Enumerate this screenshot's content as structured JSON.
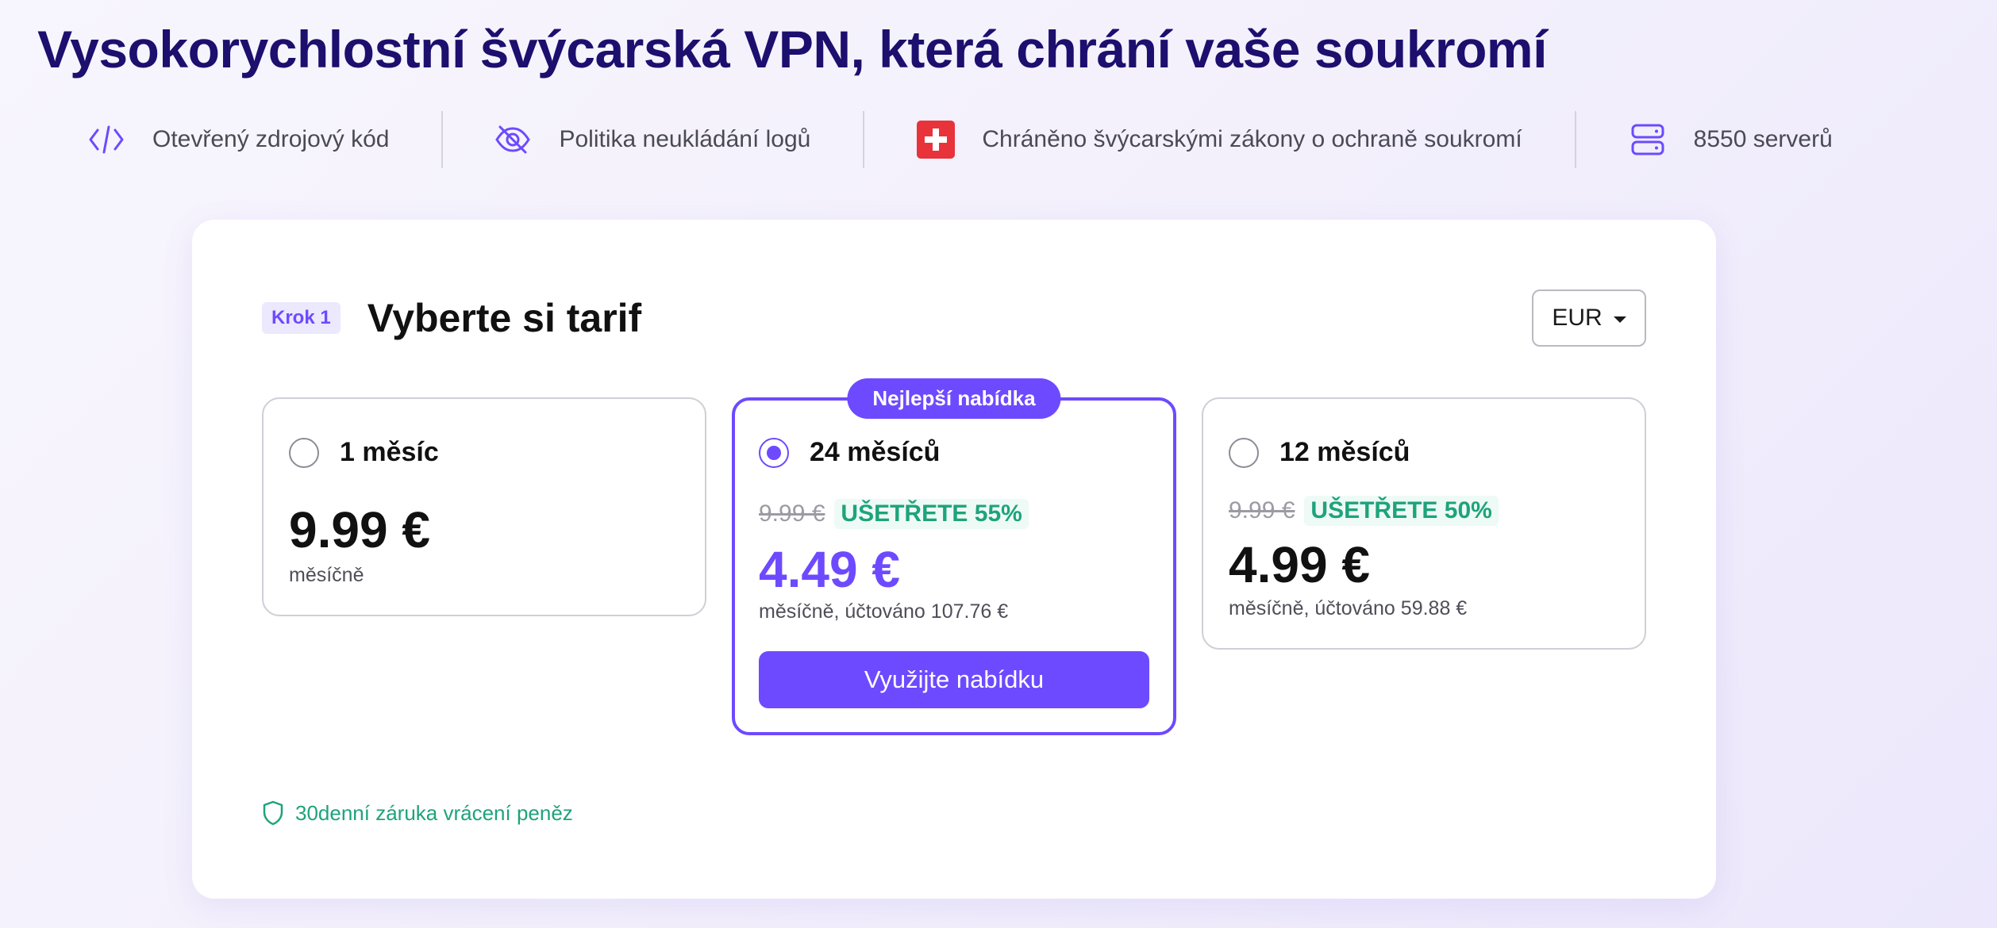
{
  "headline": "Vysokorychlostní švýcarská VPN, která chrání vaše soukromí",
  "features": [
    {
      "icon": "code-icon",
      "label": "Otevřený zdrojový kód"
    },
    {
      "icon": "eye-slash-icon",
      "label": "Politika neukládání logů"
    },
    {
      "icon": "swiss-flag-icon",
      "label": "Chráněno švýcarskými zákony o ochraně soukromí"
    },
    {
      "icon": "server-icon",
      "label": "8550 serverů"
    }
  ],
  "step": {
    "badge": "Krok 1",
    "title": "Vyberte si tarif"
  },
  "currency": {
    "selected": "EUR"
  },
  "plans": [
    {
      "name": "1 měsíc",
      "price": "9.99 €",
      "note": "měsíčně",
      "selected": false
    },
    {
      "name": "24 měsíců",
      "badge": "Nejlepší nabídka",
      "old_price": "9.99 €",
      "save": "UŠETŘETE 55%",
      "price": "4.49 €",
      "note": "měsíčně, účtováno 107.76 €",
      "cta": "Využijte nabídku",
      "selected": true
    },
    {
      "name": "12 měsíců",
      "old_price": "9.99 €",
      "save": "UŠETŘETE 50%",
      "price": "4.99 €",
      "note": "měsíčně, účtováno 59.88 €",
      "selected": false
    }
  ],
  "guarantee": "30denní záruka vrácení peněz",
  "colors": {
    "accent": "#6d4aff",
    "heading": "#1c0f6e",
    "success": "#1ea37b",
    "flag": "#e8333a"
  }
}
